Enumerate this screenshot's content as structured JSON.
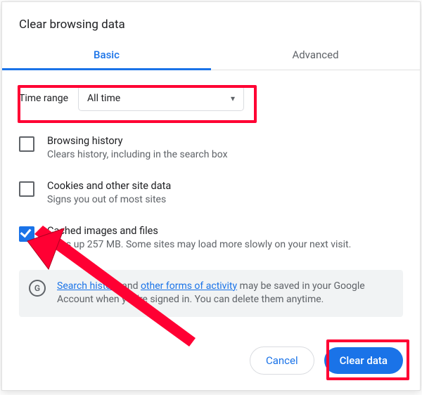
{
  "title": "Clear browsing data",
  "tabs": {
    "basic": "Basic",
    "advanced": "Advanced"
  },
  "time_range": {
    "label": "Time range",
    "value": "All time"
  },
  "options": [
    {
      "title": "Browsing history",
      "desc": "Clears history, including in the search box",
      "checked": false
    },
    {
      "title": "Cookies and other site data",
      "desc": "Signs you out of most sites",
      "checked": false
    },
    {
      "title": "Cached images and files",
      "desc": "Frees up 257 MB. Some sites may load more slowly on your next visit.",
      "checked": true
    }
  ],
  "notice": {
    "prefix": "",
    "link1": "Search history",
    "mid1": " and ",
    "link2": "other forms of activity",
    "mid2": " may be saved in your Google Account when you're signed in. You can delete them anytime."
  },
  "buttons": {
    "cancel": "Cancel",
    "clear": "Clear data"
  },
  "icons": {
    "google_g": "G"
  },
  "colors": {
    "accent": "#1a73e8",
    "annotation": "#ff0033"
  }
}
